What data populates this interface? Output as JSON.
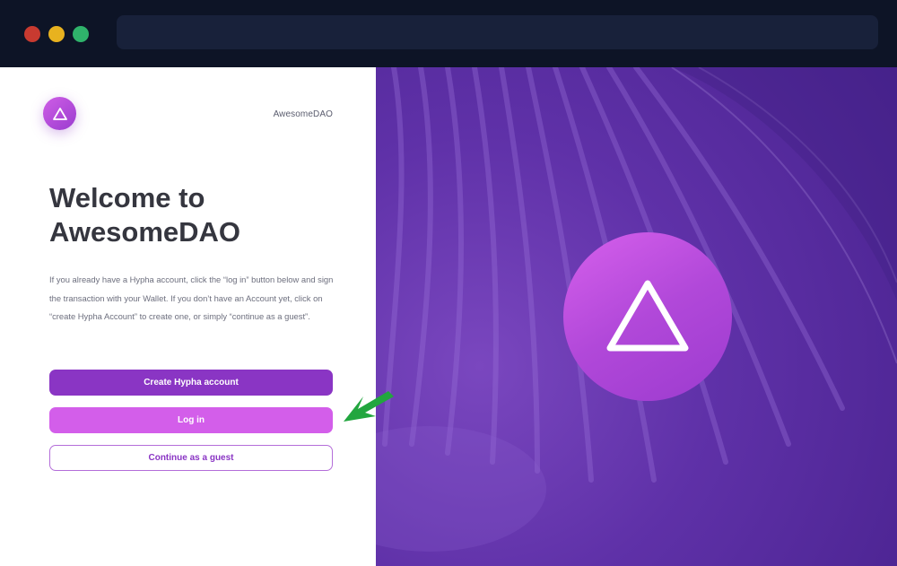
{
  "browser": {
    "buttons": [
      "close",
      "minimize",
      "maximize"
    ]
  },
  "header": {
    "brand": "AwesomeDAO",
    "logo_icon": "triangle-icon"
  },
  "welcome": {
    "title_line1": "Welcome to",
    "title_line2": "AwesomeDAO",
    "description": "If you already have a Hypha account, click the “log in” button below and sign the transaction with your Wallet. If you don’t have an Account yet, click on “create Hypha Account” to create one, or simply “continue as a guest”."
  },
  "actions": {
    "create_label": "Create Hypha account",
    "login_label": "Log in",
    "guest_label": "Continue as a guest"
  },
  "colors": {
    "primary": "#8a35c4",
    "secondary": "#d35eea",
    "annotation_arrow": "#22a63f"
  },
  "annotation": {
    "icon": "arrow-icon"
  }
}
